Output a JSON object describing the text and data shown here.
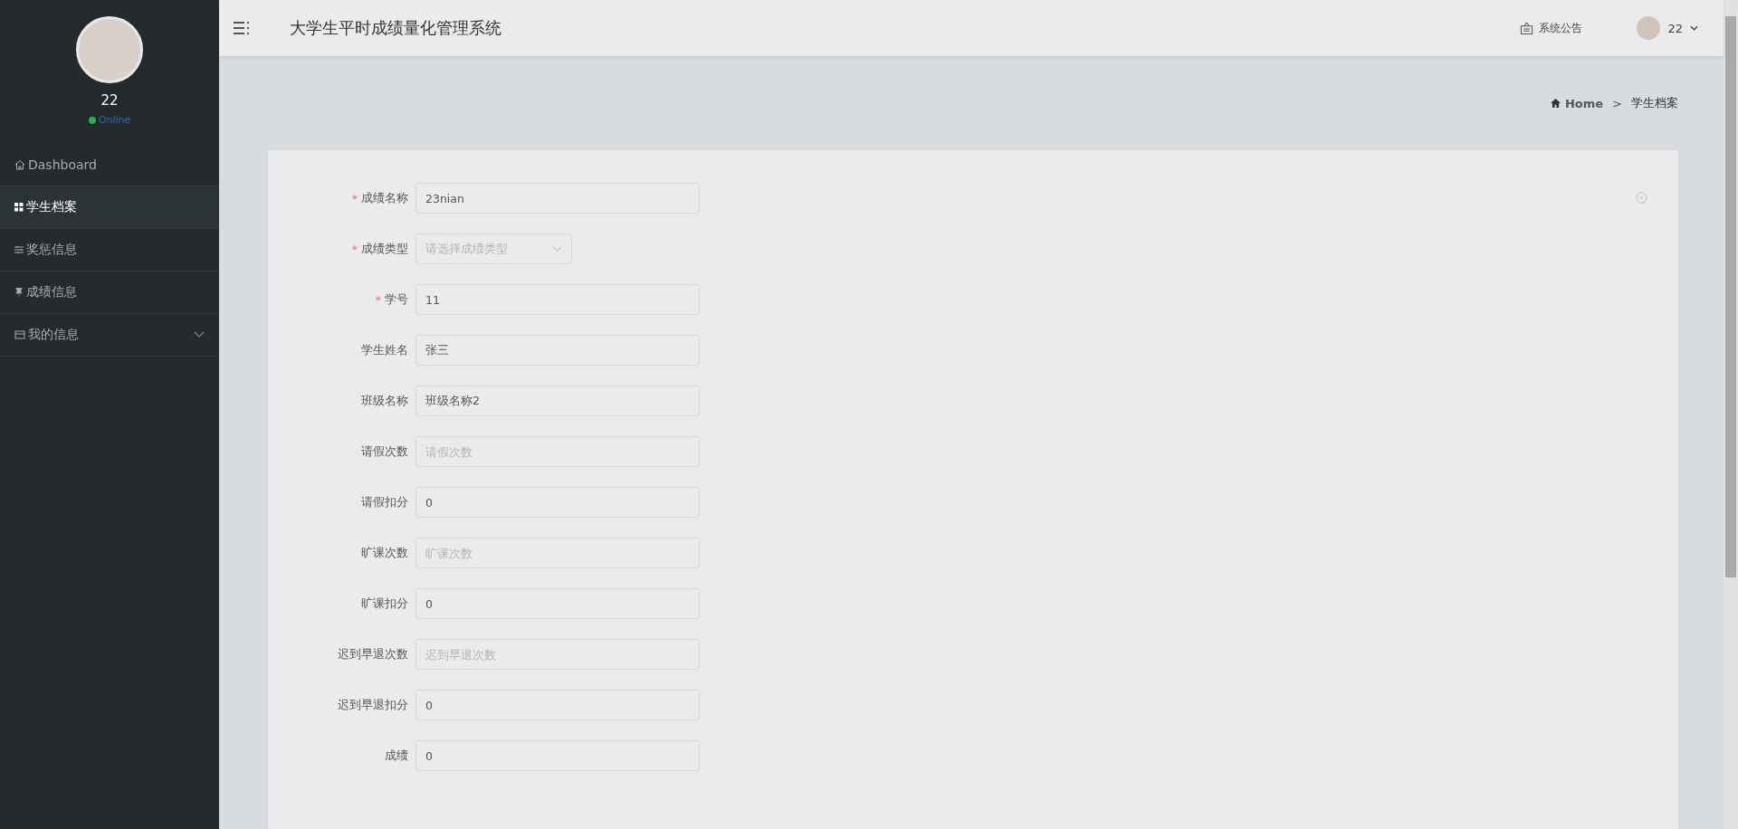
{
  "sidebar": {
    "user": {
      "name": "22",
      "status": "Online",
      "online": true
    },
    "items": [
      {
        "label": "Dashboard",
        "selected": false
      },
      {
        "label": "学生档案",
        "selected": true
      },
      {
        "label": "奖惩信息",
        "selected": false
      },
      {
        "label": "成绩信息",
        "selected": false
      },
      {
        "label": "我的信息",
        "selected": false,
        "expanded": false
      }
    ]
  },
  "header": {
    "title": "大学生平时成绩量化管理系统",
    "notice": "系统公告",
    "user": "22"
  },
  "breadcrumb": {
    "home": "Home",
    "separator": ">",
    "current": "学生档案"
  },
  "form": {
    "fields": [
      {
        "label": "成绩名称",
        "kind": "input",
        "required_mark": "*",
        "value": "23nian"
      },
      {
        "label": "成绩类型",
        "kind": "select",
        "required_mark": "*",
        "placeholder": "请选择成绩类型"
      },
      {
        "label": "学号",
        "kind": "input",
        "required_mark": "*",
        "value": "11"
      },
      {
        "label": "学生姓名",
        "kind": "input",
        "value": "张三"
      },
      {
        "label": "班级名称",
        "kind": "input",
        "value": "班级名称2"
      },
      {
        "label": "请假次数",
        "kind": "input",
        "placeholder": "请假次数"
      },
      {
        "label": "请假扣分",
        "kind": "input",
        "value": "0"
      },
      {
        "label": "旷课次数",
        "kind": "input",
        "placeholder": "旷课次数"
      },
      {
        "label": "旷课扣分",
        "kind": "input",
        "value": "0"
      },
      {
        "label": "迟到早退次数",
        "kind": "input",
        "placeholder": "迟到早退次数"
      },
      {
        "label": "迟到早退扣分",
        "kind": "input",
        "value": "0"
      },
      {
        "label": "成绩",
        "kind": "input",
        "value": "0"
      }
    ]
  }
}
